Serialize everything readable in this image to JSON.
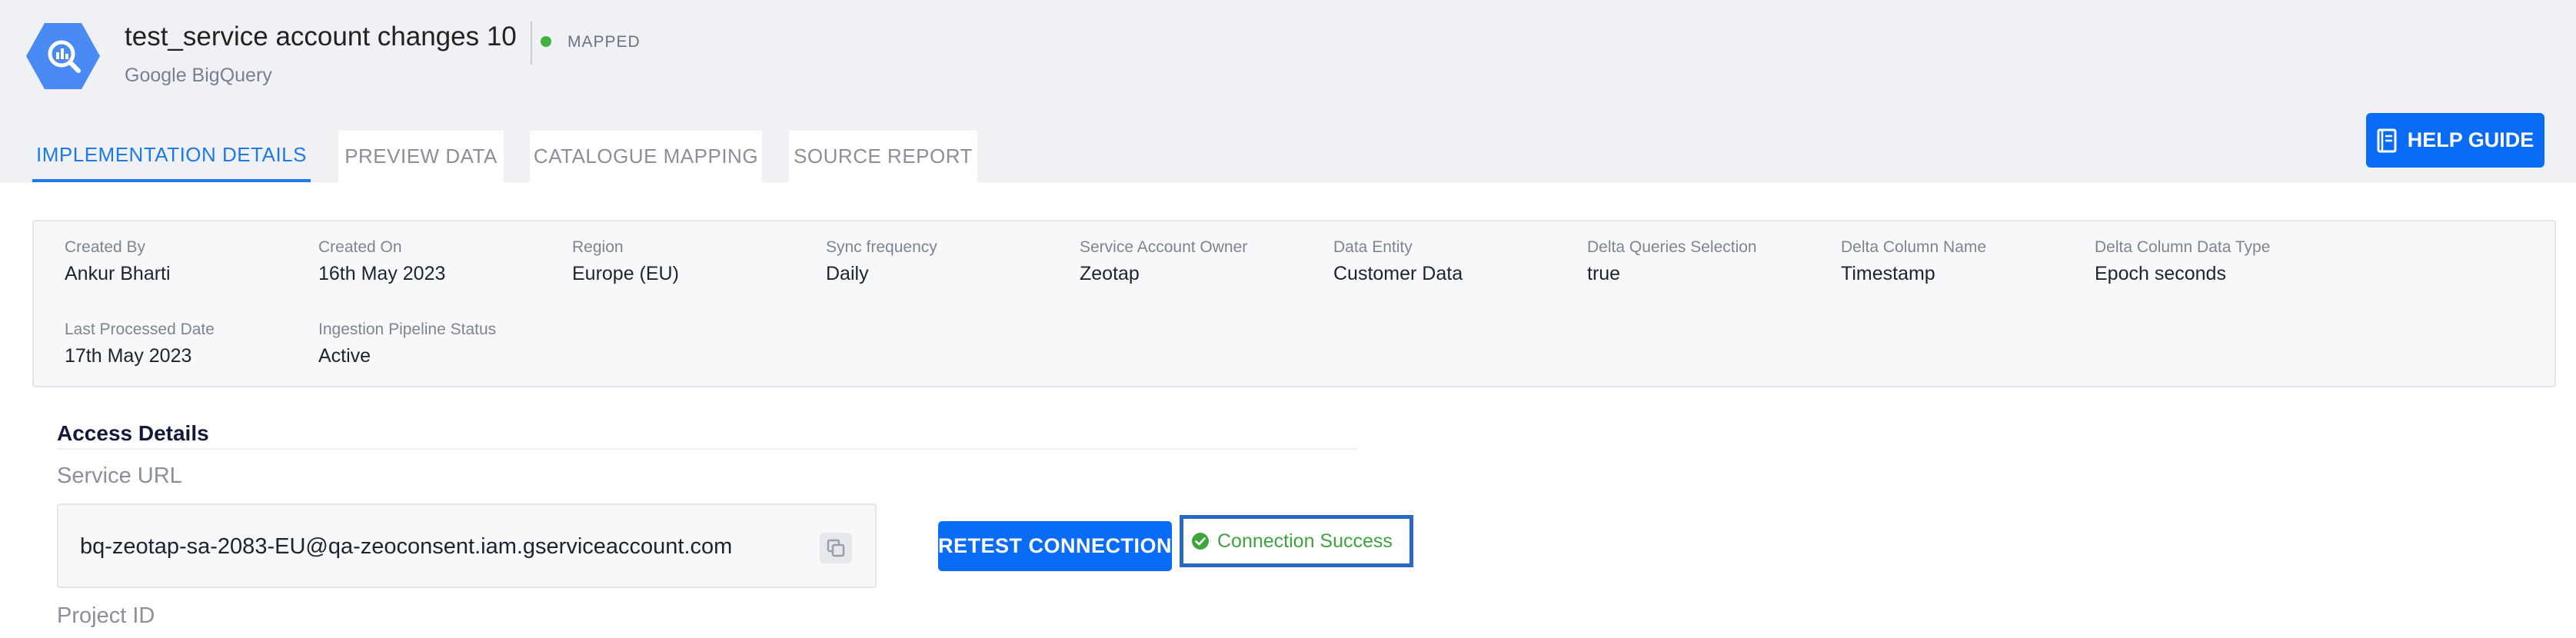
{
  "header": {
    "title": "test_service account changes 10",
    "status": "MAPPED",
    "subtitle": "Google BigQuery",
    "logo_icon": "bigquery-logo-icon",
    "status_color": "#3fb33f"
  },
  "tabs": [
    {
      "label": "IMPLEMENTATION DETAILS",
      "active": true
    },
    {
      "label": "PREVIEW DATA",
      "active": false
    },
    {
      "label": "CATALOGUE MAPPING",
      "active": false
    },
    {
      "label": "SOURCE REPORT",
      "active": false
    }
  ],
  "help_guide": {
    "label": "HELP GUIDE",
    "icon": "book-icon"
  },
  "details": [
    {
      "label": "Created By",
      "value": "Ankur Bharti"
    },
    {
      "label": "Created On",
      "value": "16th May 2023"
    },
    {
      "label": "Region",
      "value": "Europe (EU)"
    },
    {
      "label": "Sync frequency",
      "value": "Daily"
    },
    {
      "label": "Service Account Owner",
      "value": "Zeotap"
    },
    {
      "label": "Data Entity",
      "value": "Customer Data"
    },
    {
      "label": "Delta Queries Selection",
      "value": "true"
    },
    {
      "label": "Delta Column Name",
      "value": "Timestamp"
    },
    {
      "label": "Delta Column Data Type",
      "value": "Epoch seconds"
    },
    {
      "label": "Last Processed Date",
      "value": "17th May 2023"
    },
    {
      "label": "Ingestion Pipeline Status",
      "value": "Active"
    }
  ],
  "access": {
    "title": "Access Details",
    "service_url_label": "Service URL",
    "service_url": "bq-zeotap-sa-2083-EU@qa-zeoconsent.iam.gserviceaccount.com",
    "copy_icon": "copy-icon",
    "retest_label": "RETEST CONNECTION",
    "connection_status": "Connection Success",
    "success_icon": "check-circle-icon",
    "project_id_label": "Project ID"
  },
  "colors": {
    "accent": "#0a6cf5",
    "active_tab": "#1e7ae8",
    "success": "#3fa33f",
    "highlight_border": "#2a69c2"
  }
}
